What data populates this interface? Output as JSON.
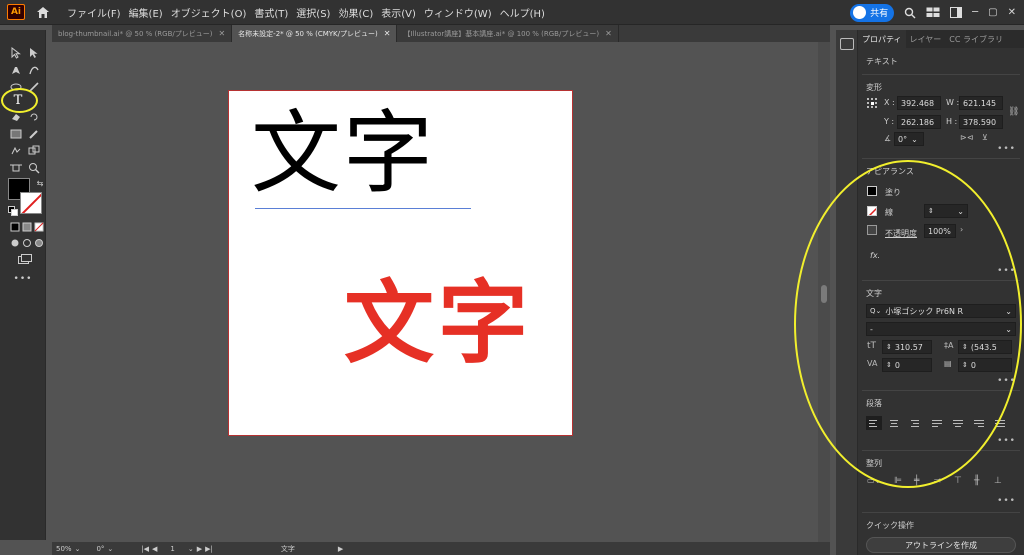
{
  "app": {
    "logo_text": "Ai"
  },
  "menu": {
    "items": [
      "ファイル(F)",
      "編集(E)",
      "オブジェクト(O)",
      "書式(T)",
      "選択(S)",
      "効果(C)",
      "表示(V)",
      "ウィンドウ(W)",
      "ヘルプ(H)"
    ],
    "share_label": "共有"
  },
  "tabs": [
    {
      "label": "blog-thumbnail.ai* @ 50 % (RGB/プレビュー)",
      "active": false
    },
    {
      "label": "名称未設定-2* @ 50 % (CMYK/プレビュー)",
      "active": true
    },
    {
      "label": "【Illustrator講座】基本講座.ai* @ 100 % (RGB/プレビュー)",
      "active": false
    }
  ],
  "canvas": {
    "text_black": "文字",
    "text_red": "文字",
    "colors": {
      "artboard_border": "#b63232",
      "red_text": "#e63025",
      "baseline": "#5a7fd6"
    }
  },
  "status": {
    "zoom": "50%",
    "rotation": "0°",
    "artboard": "1",
    "tool": "文字"
  },
  "panel": {
    "tabs": [
      "プロパティ",
      "レイヤー",
      "CC ライブラリ"
    ],
    "object_type": "テキスト",
    "transform": {
      "title": "変形",
      "x_label": "X :",
      "x": "392.468",
      "y_label": "Y :",
      "y": "262.186",
      "w_label": "W :",
      "w": "621.145",
      "h_label": "H :",
      "h": "378.590",
      "angle": "0°"
    },
    "appearance": {
      "title": "アピアランス",
      "fill_label": "塗り",
      "stroke_label": "線",
      "opacity_label": "不透明度",
      "opacity": "100%",
      "fx_label": "fx."
    },
    "character": {
      "title": "文字",
      "font": "小塚ゴシック Pr6N R",
      "style": "-",
      "size": "310.57",
      "leading": "(543.5",
      "kerning": "0",
      "tracking": "0"
    },
    "paragraph": {
      "title": "段落"
    },
    "align": {
      "title": "整列"
    },
    "quick_actions": {
      "title": "クイック操作",
      "outline_button": "アウトラインを作成"
    }
  },
  "accent": {
    "highlight": "#f1ef2d",
    "share": "#1473e6"
  }
}
